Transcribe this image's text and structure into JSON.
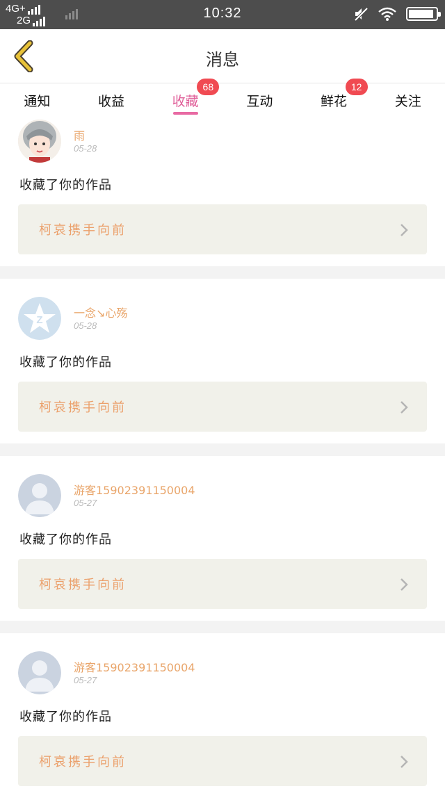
{
  "status_bar": {
    "network_top": "4G+",
    "network_bottom": "2G",
    "time": "10:32",
    "battery_level": 0.92
  },
  "header": {
    "title": "消息"
  },
  "tabs": [
    {
      "label": "通知",
      "badge": ""
    },
    {
      "label": "收益",
      "badge": ""
    },
    {
      "label": "收藏",
      "badge": "68",
      "active": true
    },
    {
      "label": "互动",
      "badge": ""
    },
    {
      "label": "鲜花",
      "badge": "12"
    },
    {
      "label": "关注",
      "badge": ""
    }
  ],
  "messages": [
    {
      "user": "雨",
      "date": "05-28",
      "action": "收藏了你的作品",
      "work_title": "柯哀携手向前",
      "avatar": "anime-avatar"
    },
    {
      "user": "一念↘心殇",
      "date": "05-28",
      "action": "收藏了你的作品",
      "work_title": "柯哀携手向前",
      "avatar": "qzone-avatar"
    },
    {
      "user": "游客15902391150004",
      "date": "05-27",
      "action": "收藏了你的作品",
      "work_title": "柯哀携手向前",
      "avatar": "default-avatar"
    },
    {
      "user": "游客15902391150004",
      "date": "05-27",
      "action": "收藏了你的作品",
      "work_title": "柯哀携手向前",
      "avatar": "default-avatar"
    }
  ],
  "colors": {
    "accent": "#e86aa3",
    "badge": "#f04a52",
    "username": "#e9a56a",
    "work_title": "#eba06b",
    "work_box": "#f1f1ea",
    "back_icon": "#e8c238"
  }
}
